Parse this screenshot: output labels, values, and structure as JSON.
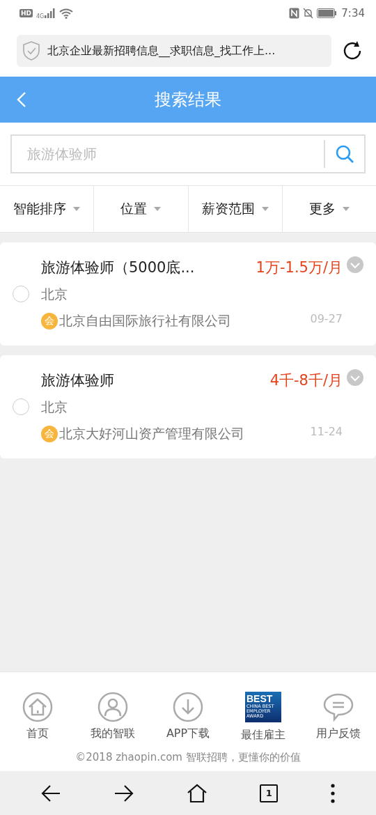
{
  "status_bar": {
    "time": "7:34",
    "network": "4G",
    "hd": "HD"
  },
  "address_bar": {
    "title": "北京企业最新招聘信息__求职信息_找工作上..."
  },
  "header": {
    "title": "搜索结果"
  },
  "search": {
    "placeholder": "旅游体验师"
  },
  "filters": [
    {
      "label": "智能排序"
    },
    {
      "label": "位置"
    },
    {
      "label": "薪资范围"
    },
    {
      "label": "更多"
    }
  ],
  "jobs": [
    {
      "title": "旅游体验师（5000底...",
      "salary": "1万-1.5万/月",
      "city": "北京",
      "badge": "会",
      "company": "北京自由国际旅行社有限公司",
      "date": "09-27",
      "selected": false
    },
    {
      "title": "旅游体验师",
      "salary": "4千-8千/月",
      "city": "北京",
      "badge": "会",
      "company": "北京大好河山资产管理有限公司",
      "date": "11-24",
      "selected": false
    }
  ],
  "footer_nav": [
    {
      "kind": "home",
      "label": "首页"
    },
    {
      "kind": "user",
      "label": "我的智联"
    },
    {
      "kind": "download",
      "label": "APP下载"
    },
    {
      "kind": "logo",
      "label": "最佳雇主",
      "logo_title": "BEST",
      "logo_subtitle": "CHINA BEST EMPLOYER AWARD"
    },
    {
      "kind": "chat",
      "label": "用户反馈"
    }
  ],
  "copyright": "©2018 zhaopin.com 智联招聘，更懂你的价值",
  "browser_nav": {
    "tab_count": "1"
  }
}
